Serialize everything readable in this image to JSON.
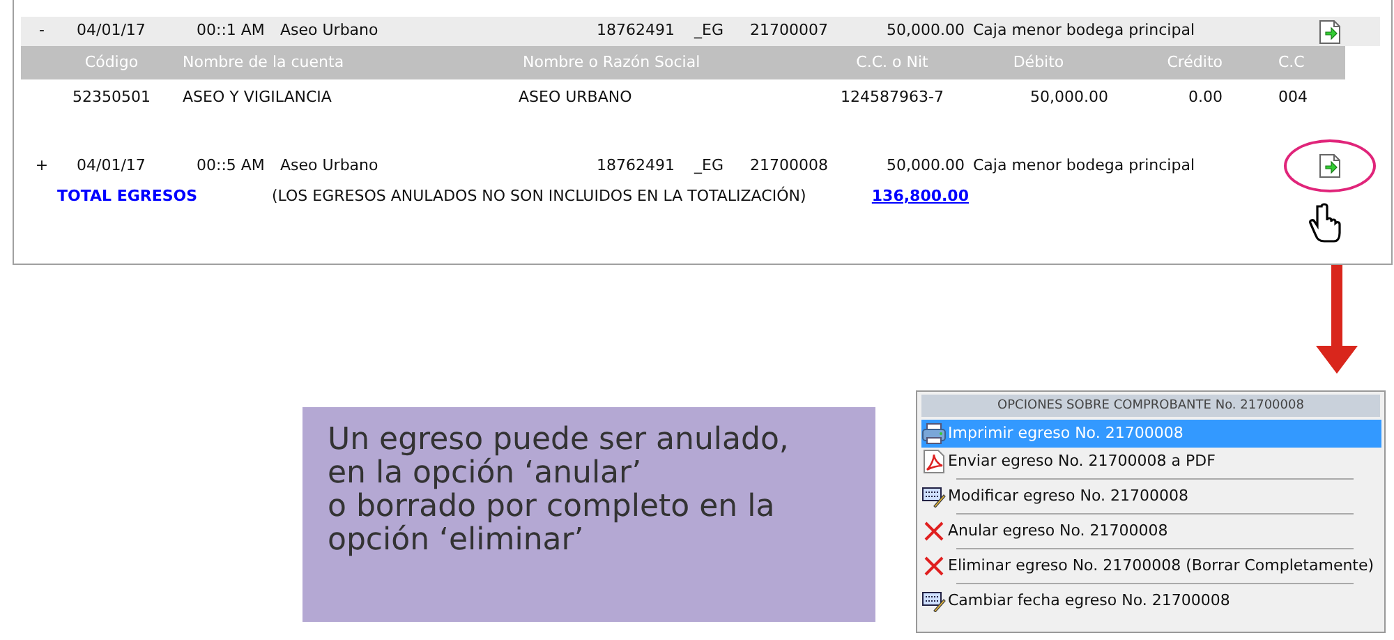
{
  "egresos": [
    {
      "expander": "-",
      "date": "04/01/17",
      "time": "00::1 AM",
      "name": "Aseo Urbano",
      "id": "18762491",
      "type": "_EG",
      "number": "21700007",
      "amount": "50,000.00",
      "concept": "Caja menor bodega principal",
      "expanded": true,
      "highlighted": false,
      "detail": {
        "columns": [
          "Código",
          "Nombre de la cuenta",
          "Nombre o Razón Social",
          "C.C. o Nit",
          "Débito",
          "Crédito",
          "C.C"
        ],
        "rows": [
          [
            "52350501",
            "ASEO Y VIGILANCIA",
            "ASEO URBANO",
            "124587963-7",
            "50,000.00",
            "0.00",
            "004"
          ]
        ]
      }
    },
    {
      "expander": "+",
      "date": "04/01/17",
      "time": "00::5 AM",
      "name": "Aseo Urbano",
      "id": "18762491",
      "type": "_EG",
      "number": "21700008",
      "amount": "50,000.00",
      "concept": "Caja menor bodega principal",
      "expanded": false,
      "highlighted": true
    }
  ],
  "total": {
    "label": "TOTAL EGRESOS",
    "note": "(LOS EGRESOS ANULADOS NO SON INCLUIDOS EN LA TOTALIZACIÓN)",
    "value": "136,800.00"
  },
  "callout": [
    "Un egreso puede ser anulado,",
    "en la opción ‘anular’",
    "o borrado por completo en la",
    "opción ‘eliminar’"
  ],
  "menu": {
    "title": "OPCIONES SOBRE COMPROBANTE No. 21700008",
    "items": [
      {
        "kind": "print",
        "label": "Imprimir egreso No. 21700008",
        "selected": true
      },
      {
        "kind": "pdf",
        "label": "Enviar egreso No. 21700008 a PDF",
        "selected": false
      },
      {
        "kind": "edit",
        "label": "Modificar egreso No. 21700008",
        "selected": false
      },
      {
        "kind": "cancel",
        "label": "Anular egreso No. 21700008",
        "selected": false
      },
      {
        "kind": "cancel",
        "label": "Eliminar egreso No. 21700008 (Borrar Completamente)",
        "selected": false
      },
      {
        "kind": "edit",
        "label": "Cambiar fecha egreso No. 21700008",
        "selected": false
      }
    ]
  }
}
